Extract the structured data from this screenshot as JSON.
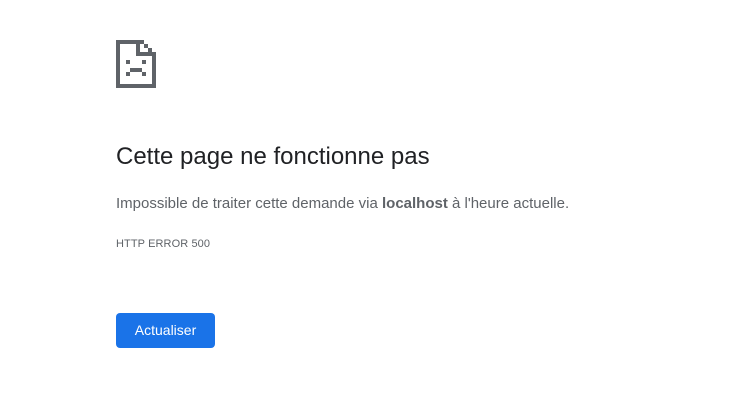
{
  "icon": "broken-page-sad-face-icon",
  "headline": "Cette page ne fonctionne pas",
  "message": {
    "prefix": "Impossible de traiter cette demande via ",
    "host": "localhost",
    "suffix": " à l'heure actuelle."
  },
  "error_code": "HTTP ERROR 500",
  "reload_button_label": "Actualiser",
  "colors": {
    "button_bg": "#1a73e8",
    "headline": "#202124",
    "body_text": "#5f6368",
    "icon": "#5f6368"
  }
}
